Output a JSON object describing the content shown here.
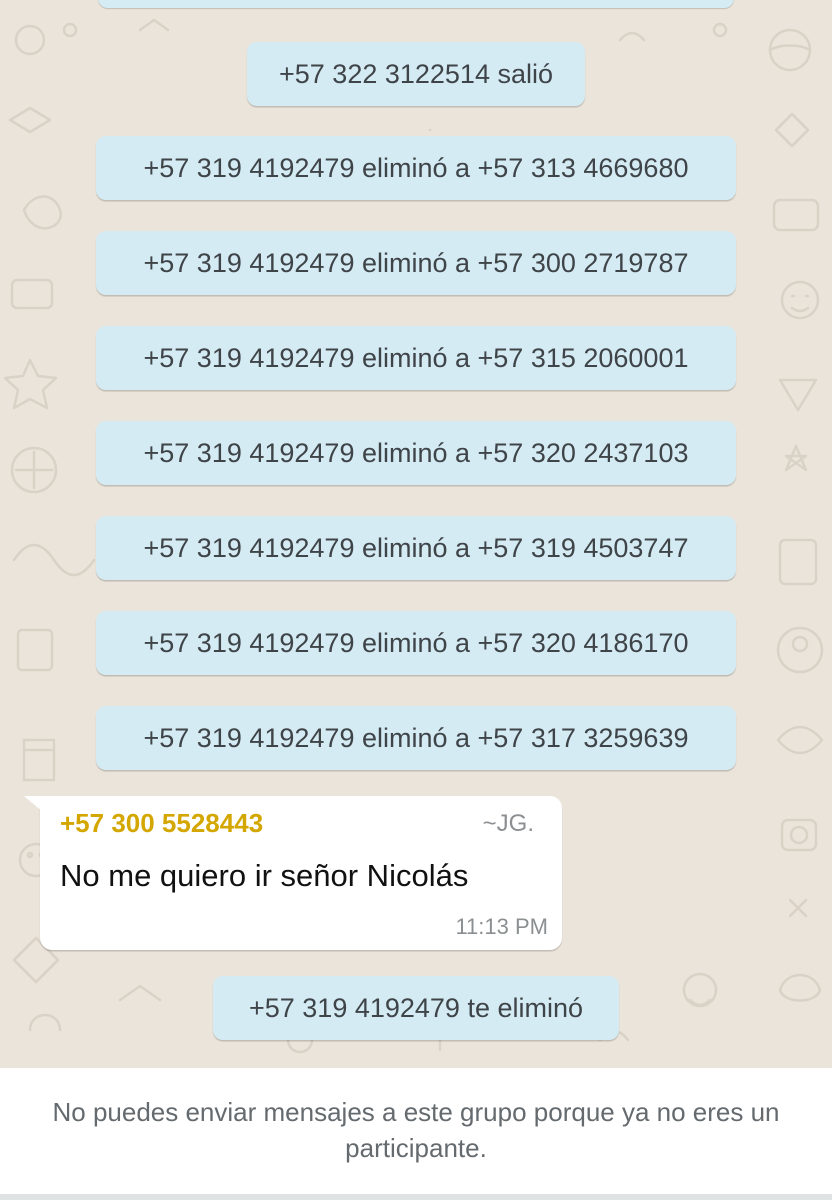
{
  "chat": {
    "system_messages": [
      "+57 322 3122514 salió",
      "+57 319 4192479 eliminó a +57 313 4669680",
      "+57 319 4192479 eliminó a +57 300 2719787",
      "+57 319 4192479 eliminó a +57 315 2060001",
      "+57 319 4192479 eliminó a +57 320 2437103",
      "+57 319 4192479 eliminó a +57 319 4503747",
      "+57 319 4192479 eliminó a +57 320 4186170",
      "+57 319 4192479 eliminó a +57 317 3259639"
    ],
    "incoming_message": {
      "sender": "+57 300 5528443",
      "sender_alias": "~JG.",
      "text": "No me quiero ir señor Nicolás",
      "time": "11:13 PM"
    },
    "final_system_message": "+57 319 4192479 te eliminó"
  },
  "footer": {
    "notice": "No puedes enviar mensajes a este grupo porque ya no eres un participante."
  },
  "colors": {
    "chat_background": "#ebe4da",
    "system_bubble": "#d4ebf4",
    "sender_name": "#d4a700",
    "footer_background": "#ffffff"
  }
}
